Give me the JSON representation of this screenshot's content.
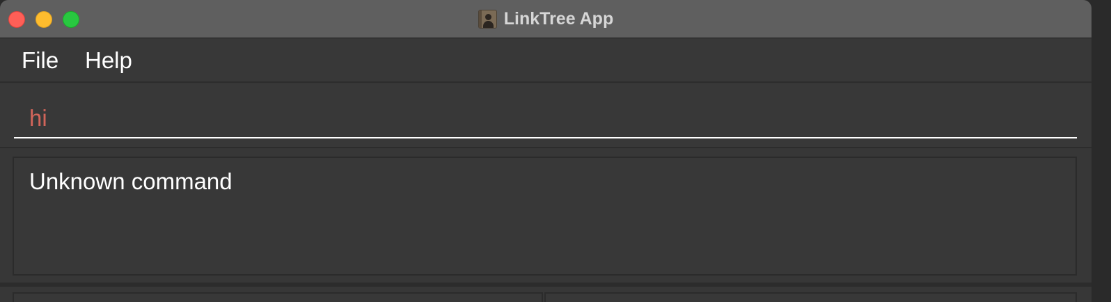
{
  "window": {
    "title": "LinkTree App"
  },
  "menu": {
    "file_label": "File",
    "help_label": "Help"
  },
  "command_box": {
    "value": "hi",
    "text_color": "#d2655a"
  },
  "result_display": {
    "text": "Unknown command"
  },
  "icons": {
    "app_icon": "contacts-book-icon"
  },
  "colors": {
    "close": "#ff5f57",
    "minimize": "#febc2e",
    "zoom": "#28c840",
    "background": "#373737"
  }
}
